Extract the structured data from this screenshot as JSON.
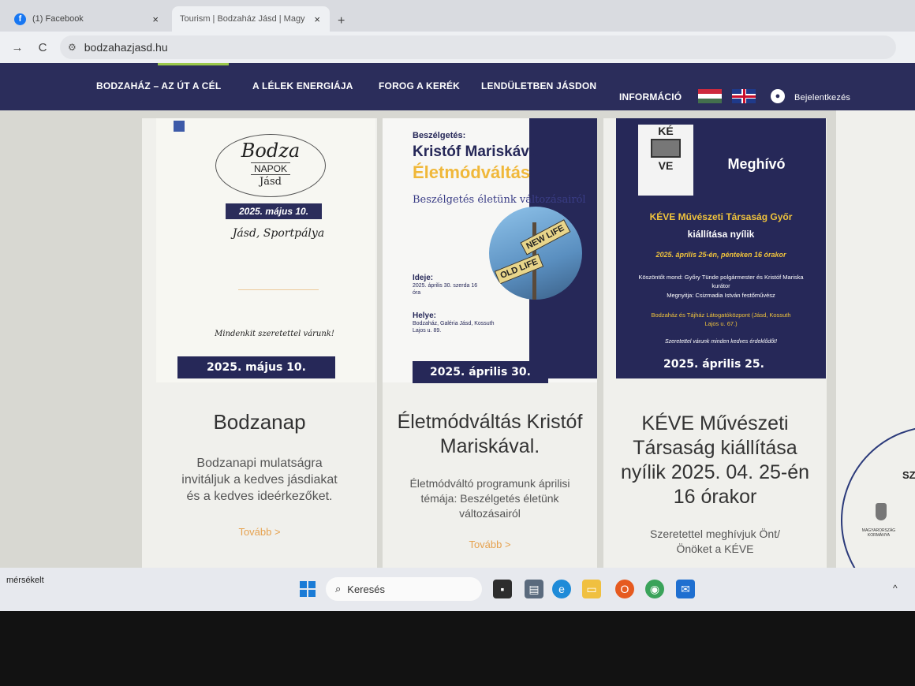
{
  "browser": {
    "tabs": [
      {
        "label": "(1) Facebook",
        "close": "×"
      },
      {
        "label": "Tourism | Bodzaház Jásd | Magy",
        "close": "×"
      }
    ],
    "new_tab": "+",
    "url": "bodzahazjasd.hu"
  },
  "nav": {
    "items": [
      "BODZAHÁZ – AZ ÚT A CÉL",
      "A LÉLEK ENERGIÁJA",
      "FOROG A KERÉK",
      "LENDÜLETBEN JÁSDON",
      "INFORMÁCIÓ"
    ],
    "login": "Bejelentkezés"
  },
  "cards": [
    {
      "poster": {
        "title": "Bodza",
        "subtitle": "NAPOK",
        "place_small": "Jásd",
        "date": "2025. május 10.",
        "location": "Jásd, Sportpálya",
        "welcome": "Mindenkit szeretettel várunk!"
      },
      "date": "2025. május 10.",
      "title": "Bodzanap",
      "text": "Bodzanapi mulatságra invitáljuk a kedves jásdiakat és a kedves ideérkezőket.",
      "more": "Tovább >"
    },
    {
      "poster": {
        "label1": "Beszélgetés:",
        "label2": "Kristóf Mariskával",
        "label3": "Életmódváltás",
        "label4": "Beszélgetés életünk változásairól",
        "sign1": "NEW LIFE",
        "sign2": "OLD LIFE",
        "when_label": "Ideje:",
        "when": "2025. április 30. szerda 16 óra",
        "where_label": "Helye:",
        "where": "Bodzaház, Galéria Jásd, Kossuth Lajos u. 89."
      },
      "date": "2025. április 30.",
      "title": "Életmódváltás Kristóf Mariskával.",
      "text": "Életmódváltó programunk áprilisi témája: Beszélgetés életünk változásairól",
      "more": "Tovább >"
    },
    {
      "poster": {
        "logo_top": "KÉ",
        "logo_bottom": "VE",
        "heading": "Meghívó",
        "org": "KÉVE Művészeti Társaság Győr",
        "opening": "kiállítása nyílik",
        "when": "2025. április 25-én, pénteken 16 órakor",
        "greeting": "Köszöntőt mond: Győry Tünde polgármester és Kristóf Mariska kurátor",
        "opener": "Megnyitja: Csizmadia István festőművész",
        "venue": "Bodzaház és Tájház Látogatóközpont (Jásd, Kossuth Lajos u. 67.)",
        "invite": "Szeretettel várunk minden kedves érdeklődőt!"
      },
      "date": "2025. április 25.",
      "title": "KÉVE Művészeti Társaság kiállítása nyílik 2025. 04. 25-én 16 órakor",
      "text": "Szeretettel meghívjuk Önt/Önöket a KÉVE"
    }
  ],
  "partial_card": {
    "text": "SZ",
    "gov": "MAGYARORSZÁG KORMÁNYA"
  },
  "taskbar": {
    "weather": "mérsékelt",
    "search_placeholder": "Keresés"
  }
}
